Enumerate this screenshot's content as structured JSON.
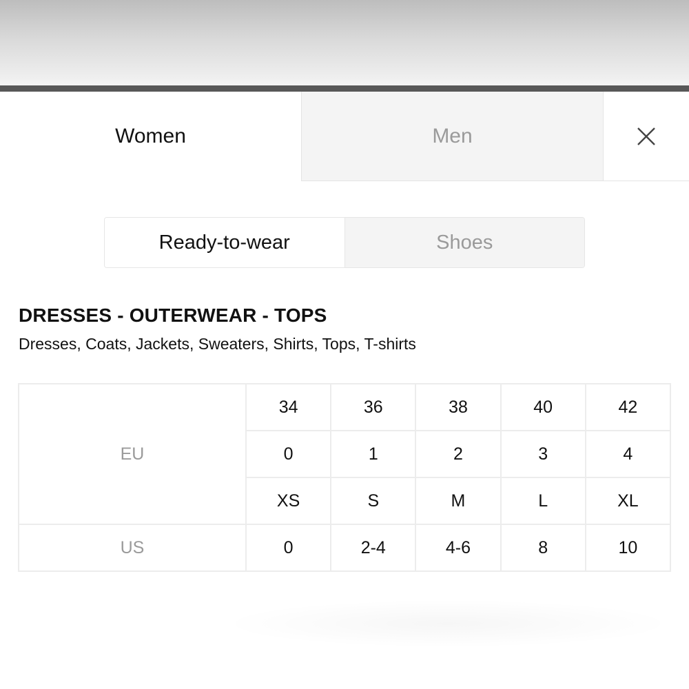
{
  "gender_tabs": {
    "women": "Women",
    "men": "Men"
  },
  "close_icon": "close-icon",
  "category_tabs": {
    "ready_to_wear": "Ready-to-wear",
    "shoes": "Shoes"
  },
  "section": {
    "title": "DRESSES - OUTERWEAR - TOPS",
    "subtitle": "Dresses, Coats, Jackets, Sweaters, Shirts, Tops, T-shirts"
  },
  "size_table": {
    "eu": {
      "label": "EU",
      "rows": [
        [
          "34",
          "36",
          "38",
          "40",
          "42"
        ],
        [
          "0",
          "1",
          "2",
          "3",
          "4"
        ],
        [
          "XS",
          "S",
          "M",
          "L",
          "XL"
        ]
      ]
    },
    "us": {
      "label": "US",
      "values": [
        "0",
        "2-4",
        "4-6",
        "8",
        "10"
      ]
    }
  },
  "colors": {
    "active_text": "#111111",
    "inactive_text": "#9a9a9a",
    "inactive_bg": "#f4f4f4",
    "divider": "#575757",
    "border": "#ececec"
  }
}
